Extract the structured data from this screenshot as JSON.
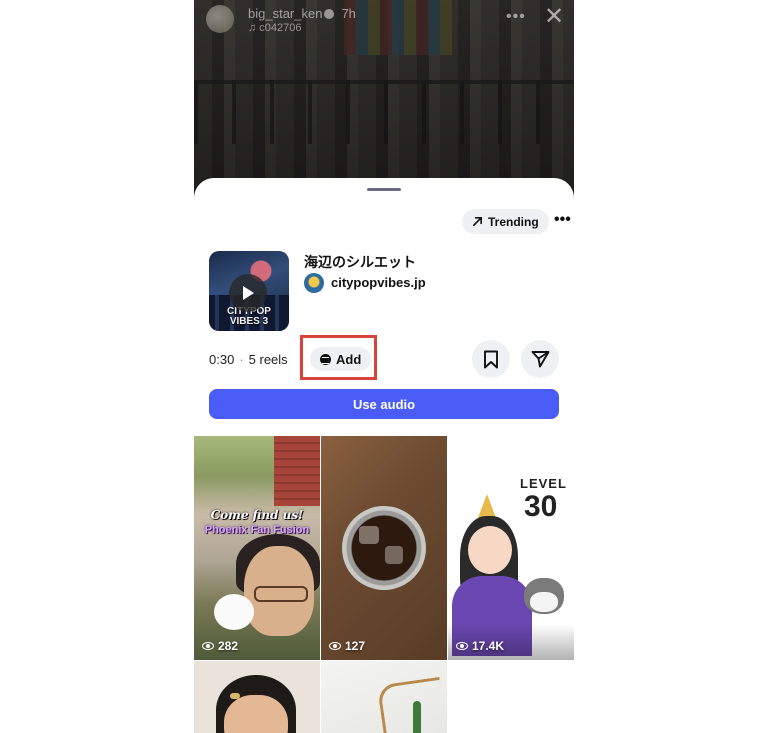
{
  "background_reel": {
    "username": "big_star_ken",
    "time_ago": "7h",
    "audio_line": "♫ c042706"
  },
  "sheet": {
    "trending_label": "Trending",
    "song": {
      "title": "海辺のシルエット",
      "artist": "citypopvibes.jp",
      "cover_text": "CITYPOP VIBES 3"
    },
    "duration": "0:30",
    "reels_count": "5 reels",
    "add_label": "Add",
    "use_audio_label": "Use audio"
  },
  "reels": [
    {
      "views": "282",
      "caption_line1": "Come find us!",
      "caption_line2": "Phoenix Fan Fusion"
    },
    {
      "views": "127"
    },
    {
      "views": "17.4K",
      "overlay_title": "LEVEL",
      "overlay_number": "30"
    },
    {
      "views": ""
    },
    {
      "views": ""
    }
  ],
  "colors": {
    "accent": "#4a5cf5",
    "highlight": "#d9433a",
    "chip_bg": "#eef0f3"
  }
}
